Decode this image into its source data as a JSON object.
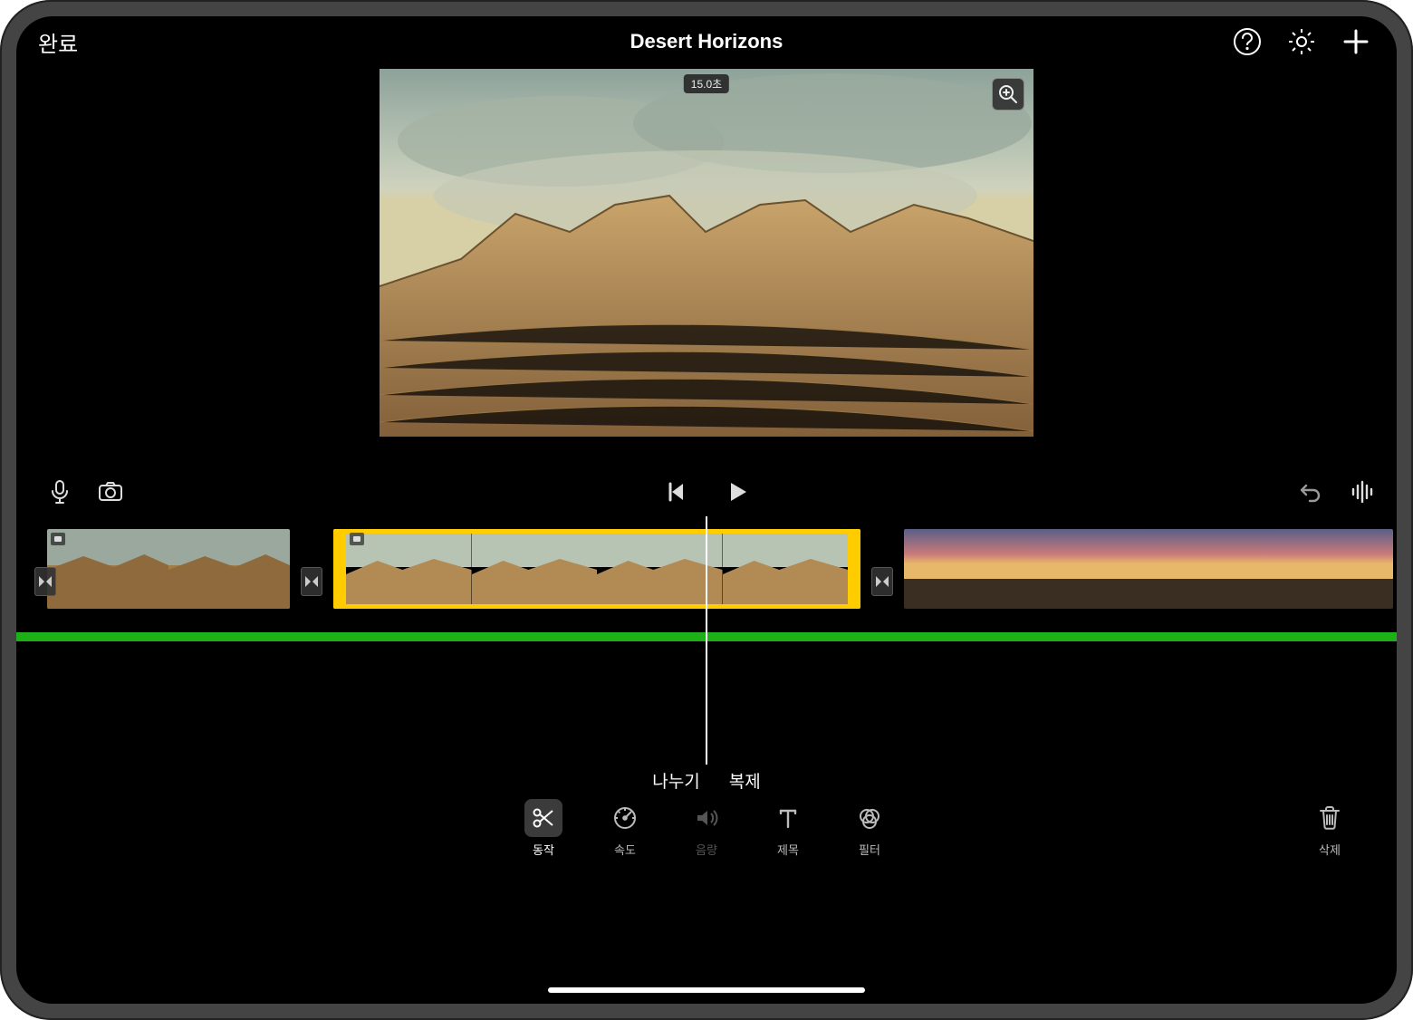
{
  "header": {
    "done": "완료",
    "title": "Desert Horizons"
  },
  "preview": {
    "duration_badge": "15.0초"
  },
  "context_actions": {
    "split": "나누기",
    "duplicate": "복제"
  },
  "tools": {
    "action": "동작",
    "speed": "속도",
    "volume": "음량",
    "title": "제목",
    "filter": "필터",
    "delete": "삭제"
  },
  "timeline": {
    "selected_clip_index": 1,
    "clips": [
      {
        "kind": "desert-dunes"
      },
      {
        "kind": "desert-rocks"
      },
      {
        "kind": "sunset"
      }
    ]
  }
}
